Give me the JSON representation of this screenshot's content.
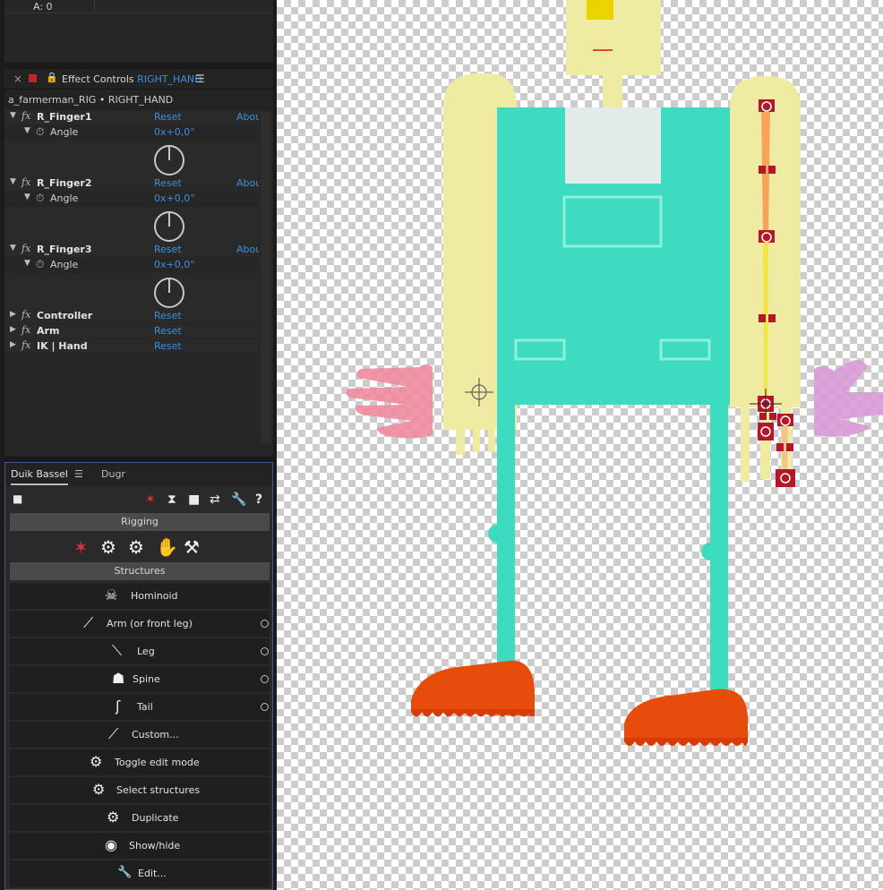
{
  "top_panel": {
    "value_readout": "A: 0"
  },
  "effect_controls": {
    "close_glyph": "×",
    "title_prefix": "Effect Controls",
    "title_layer": "RIGHT_HAND",
    "menu_glyph": "☰",
    "subtitle": "a_farmerman_RIG • RIGHT_HAND",
    "effects": [
      {
        "name": "R_Finger1",
        "reset": "Reset",
        "about": "About...",
        "param": "Angle",
        "value": "0x+0,0°"
      },
      {
        "name": "R_Finger2",
        "reset": "Reset",
        "about": "About...",
        "param": "Angle",
        "value": "0x+0,0°"
      },
      {
        "name": "R_Finger3",
        "reset": "Reset",
        "about": "About...",
        "param": "Angle",
        "value": "0x+0,0°"
      }
    ],
    "collapsed_effects": [
      {
        "name": "Controller",
        "reset": "Reset"
      },
      {
        "name": "Arm",
        "reset": "Reset"
      },
      {
        "name": "IK | Hand",
        "reset": "Reset"
      }
    ],
    "fx_glyph": "fx"
  },
  "duik": {
    "tabs": [
      {
        "label": "Duik Bassel"
      },
      {
        "label": "Dugr"
      }
    ],
    "tab_menu_glyph": "☰",
    "sections": {
      "rigging": "Rigging",
      "structures": "Structures"
    },
    "structure_buttons": [
      {
        "label": "Hominoid",
        "icon": "hominoid-icon",
        "option": false
      },
      {
        "label": "Arm (or front leg)",
        "icon": "arm-icon",
        "option": true
      },
      {
        "label": "Leg",
        "icon": "leg-icon",
        "option": true
      },
      {
        "label": "Spine",
        "icon": "spine-icon",
        "option": true
      },
      {
        "label": "Tail",
        "icon": "tail-icon",
        "option": true
      },
      {
        "label": "Custom...",
        "icon": "custom-bone-icon",
        "option": false
      },
      {
        "label": "Toggle edit mode",
        "icon": "toggle-edit-icon",
        "option": false
      },
      {
        "label": "Select structures",
        "icon": "select-structures-icon",
        "option": false
      },
      {
        "label": "Duplicate",
        "icon": "duplicate-icon",
        "option": false
      },
      {
        "label": "Show/hide",
        "icon": "show-hide-icon",
        "option": false
      },
      {
        "label": "Edit...",
        "icon": "wrench-icon",
        "option": false
      }
    ],
    "toolbar_help": "?"
  },
  "colors": {
    "accent_blue": "#3b8fe0",
    "overalls": "#3ddbbf",
    "skin": "#efeba2",
    "shoes": "#e74c0a",
    "hand_left": "#f08aa0",
    "hand_right": "#d99ad8",
    "bone_red": "#b3182a"
  }
}
